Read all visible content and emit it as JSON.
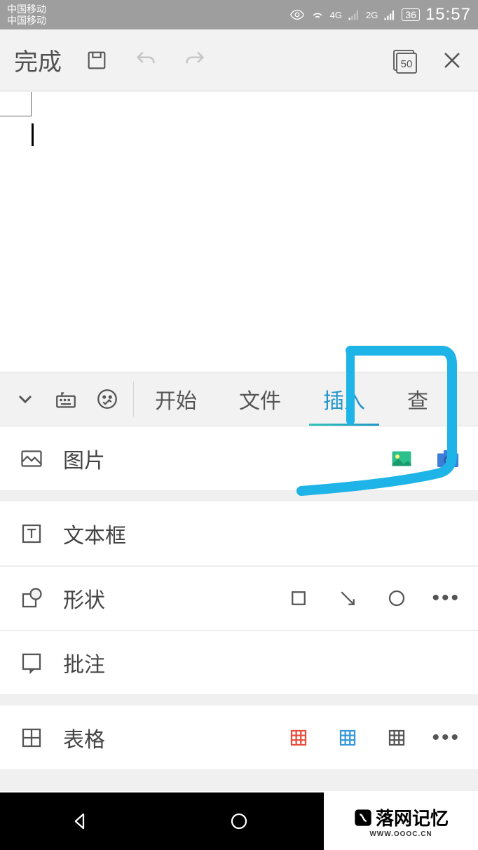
{
  "status": {
    "carrier1": "中国移动",
    "carrier2": "中国移动",
    "net1": "4G",
    "net2": "2G",
    "battery": "36",
    "time": "15:57"
  },
  "toolbar": {
    "done": "完成",
    "word_count": "50"
  },
  "tabs": {
    "t0": "开始",
    "t1": "文件",
    "t2": "插入",
    "t3": "查"
  },
  "menu": {
    "picture": "图片",
    "textbox": "文本框",
    "shape": "形状",
    "annotation": "批注",
    "table": "表格"
  },
  "watermark": {
    "main": "落网记忆",
    "sub": "WWW.OOOC.CN"
  }
}
